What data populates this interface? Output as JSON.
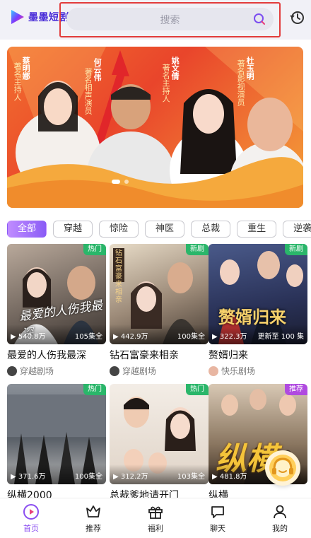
{
  "app": {
    "logo_text": "墨墨短剧"
  },
  "search": {
    "placeholder": "搜索"
  },
  "banner": {
    "people": [
      {
        "role": "著名主持人",
        "name": "蔡明娜"
      },
      {
        "role": "著名相声演员",
        "name": "何云伟"
      },
      {
        "role": "著名主持人",
        "name": "姚文倩"
      },
      {
        "role": "著名影视演员",
        "name": "杜玉明"
      }
    ]
  },
  "categories": [
    "全部",
    "穿越",
    "惊险",
    "神医",
    "总裁",
    "重生",
    "逆袭"
  ],
  "cards": [
    {
      "tag": "热门",
      "plays": "540.8万",
      "eps": "105集全",
      "title": "最爱的人伤我最深",
      "source": "穿越剧场",
      "poster_text": "最爱的人伤我最深"
    },
    {
      "tag": "新剧",
      "plays": "442.9万",
      "eps": "100集全",
      "title": "钻石富豪来相亲",
      "source": "穿越剧场",
      "poster_text": "钻石富豪来相亲"
    },
    {
      "tag": "新剧",
      "plays": "322.3万",
      "eps": "更新至 100 集",
      "title": "赘婿归来",
      "source": "快乐剧场",
      "poster_text": "赘婿归来"
    },
    {
      "tag": "热门",
      "plays": "371.6万",
      "eps": "100集全",
      "title": "纵横2000",
      "source": "",
      "poster_text": ""
    },
    {
      "tag": "热门",
      "plays": "312.2万",
      "eps": "103集全",
      "title": "总裁爹地请开门",
      "source": "",
      "poster_text": ""
    },
    {
      "tag": "推荐",
      "plays": "481.8万",
      "eps": "",
      "title": "纵横",
      "source": "",
      "poster_text": "纵横"
    }
  ],
  "nav": [
    {
      "label": "首页",
      "icon": "home-play-icon"
    },
    {
      "label": "推荐",
      "icon": "crown-icon"
    },
    {
      "label": "福利",
      "icon": "gift-icon"
    },
    {
      "label": "聊天",
      "icon": "chat-icon"
    },
    {
      "label": "我的",
      "icon": "profile-icon"
    }
  ],
  "colors": {
    "accent": "#8a4df0",
    "highlight_border": "#e23c3c",
    "tag_green": "#2ab66a",
    "tag_purple": "#b04ae0"
  }
}
